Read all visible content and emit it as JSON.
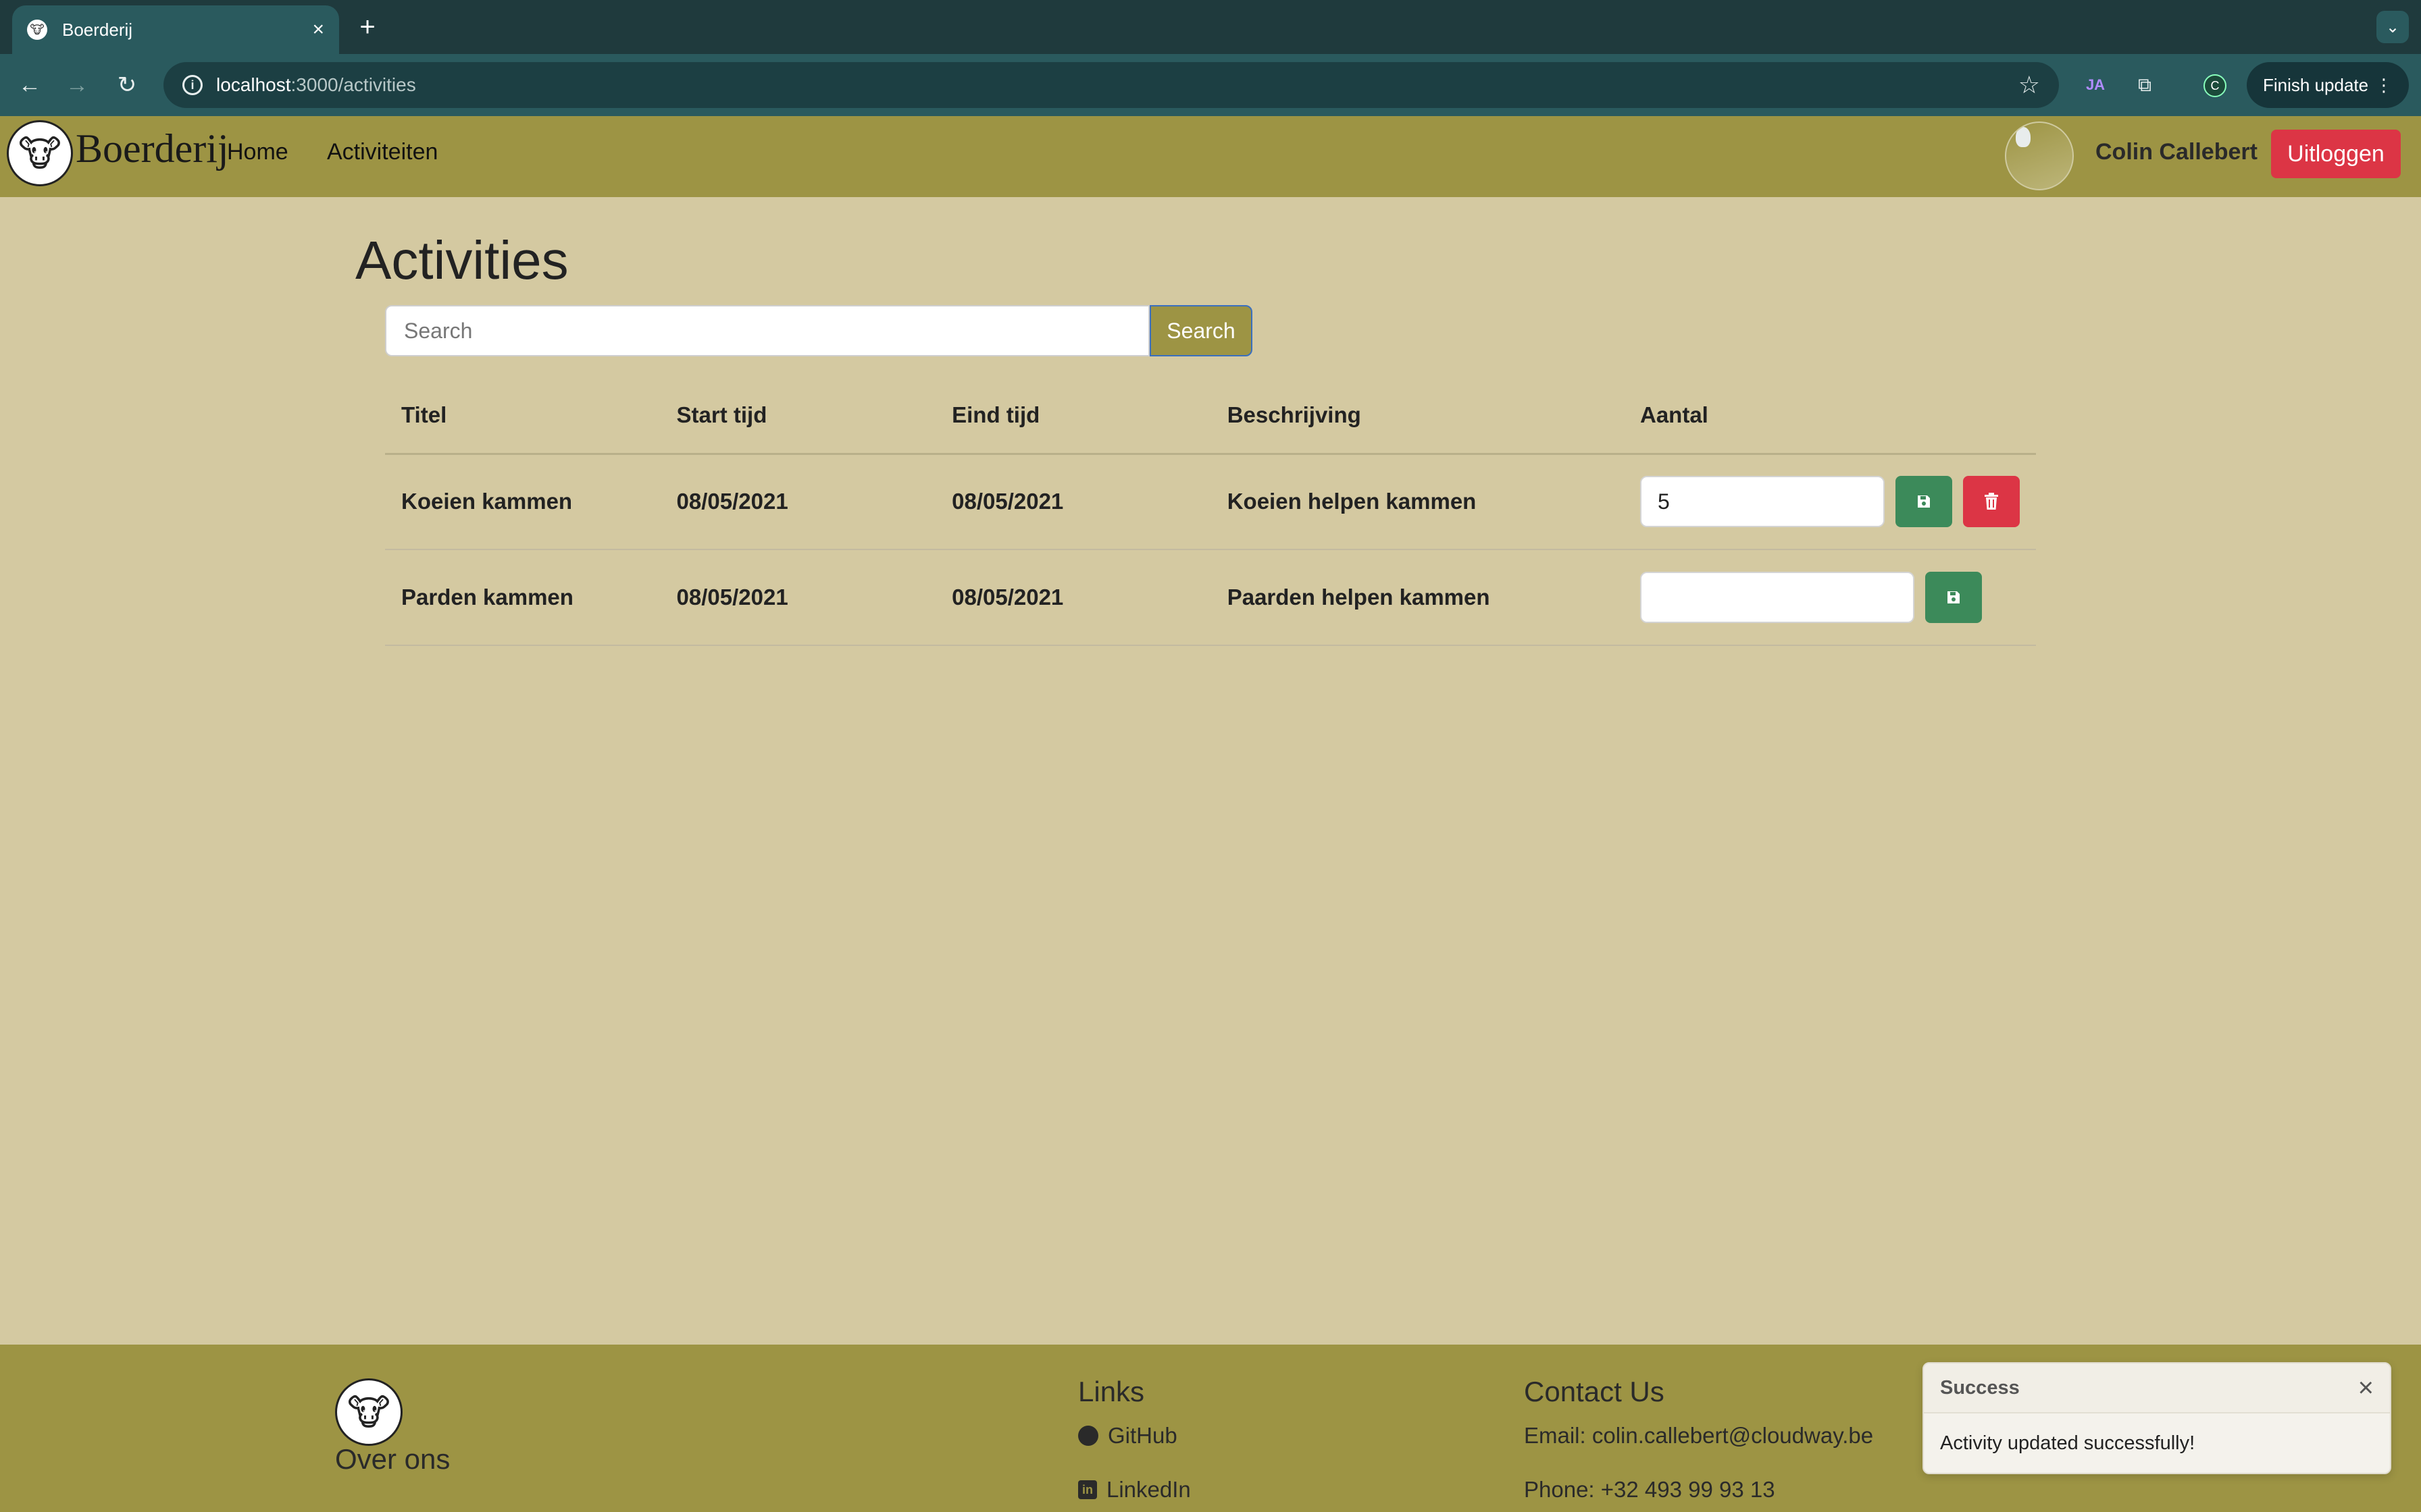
{
  "browser": {
    "tab_title": "Boerderij",
    "url_host": "localhost",
    "url_path": ":3000/activities",
    "profile_initial": "C",
    "finish_update_label": "Finish update"
  },
  "navbar": {
    "brand": "Boerderij",
    "links": [
      "Home",
      "Activiteiten"
    ],
    "user_name": "Colin Callebert",
    "logout_label": "Uitloggen"
  },
  "page": {
    "title": "Activities",
    "search_placeholder": "Search",
    "search_button": "Search"
  },
  "table": {
    "headers": [
      "Titel",
      "Start tijd",
      "Eind tijd",
      "Beschrijving",
      "Aantal"
    ],
    "rows": [
      {
        "titel": "Koeien kammen",
        "start": "08/05/2021",
        "eind": "08/05/2021",
        "beschrijving": "Koeien helpen kammen",
        "aantal": "5",
        "deletable": true
      },
      {
        "titel": "Parden kammen",
        "start": "08/05/2021",
        "eind": "08/05/2021",
        "beschrijving": "Paarden helpen kammen",
        "aantal": "",
        "deletable": false
      }
    ]
  },
  "footer": {
    "about_heading": "Over ons",
    "links_heading": "Links",
    "github": "GitHub",
    "linkedin": "LinkedIn",
    "contact_heading": "Contact Us",
    "email": "Email: colin.callebert@cloudway.be",
    "phone": "Phone: +32 493 99 93 13"
  },
  "toast": {
    "title": "Success",
    "message": "Activity updated successfully!"
  },
  "colors": {
    "navbar": "#9d9444",
    "page_bg": "#d4c9a1",
    "danger": "#dc3545",
    "success": "#3c8a5a"
  }
}
